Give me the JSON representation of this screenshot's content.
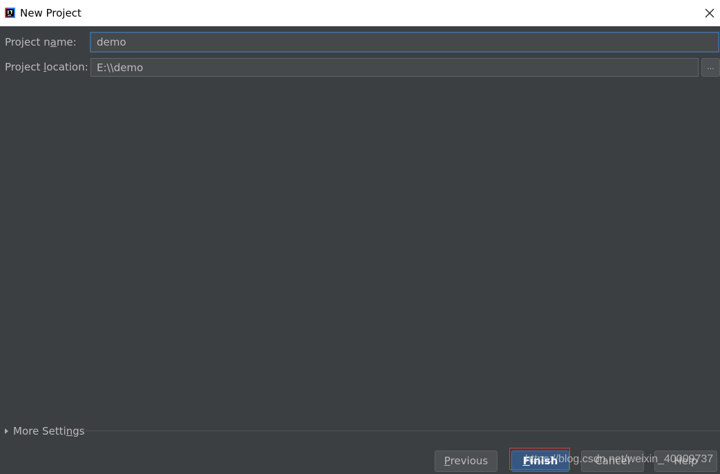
{
  "window": {
    "title": "New Project",
    "app_icon": "intellij-idea-icon",
    "close_icon": "close-icon"
  },
  "form": {
    "name_label": "Project name:",
    "name_value": "demo",
    "location_label": "Project location:",
    "location_value": "E:\\\\demo",
    "browse_label": "..."
  },
  "more_settings": {
    "label": "More Settings",
    "icon": "expand-triangle-icon"
  },
  "buttons": {
    "previous": "Previous",
    "finish": "Finish",
    "cancel": "Cancel",
    "help": "Help"
  },
  "watermark": {
    "text": "https://blog.csdn.net/weixin_40009737"
  },
  "colors": {
    "background": "#3c3f41",
    "text": "#bbbbbb",
    "field_bg": "#45494a",
    "focus_border": "#466d94",
    "primary_button": "#365880",
    "highlight": "#e03a3a"
  }
}
